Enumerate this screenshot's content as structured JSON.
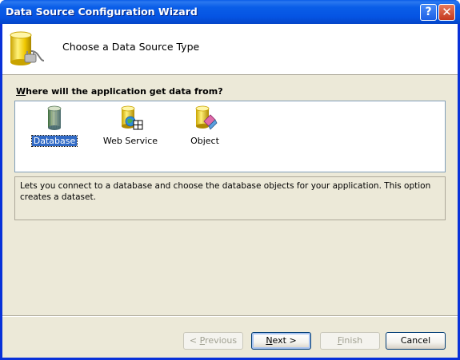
{
  "window": {
    "title": "Data Source Configuration Wizard",
    "help_glyph": "?",
    "close_glyph": "✕"
  },
  "header": {
    "title": "Choose a Data Source Type",
    "icon": "database-plug-icon"
  },
  "question": {
    "underlined_letter": "W",
    "rest": "here will the application get data from?"
  },
  "data_sources": [
    {
      "label": "Database",
      "icon": "database-icon",
      "selected": true
    },
    {
      "label": "Web Service",
      "icon": "web-service-icon",
      "selected": false
    },
    {
      "label": "Object",
      "icon": "object-icon",
      "selected": false
    }
  ],
  "description": "Lets you connect to a database and choose the database objects for your application. This option creates a dataset.",
  "buttons": {
    "previous": {
      "prefix": "< ",
      "mnemonic": "P",
      "rest": "revious",
      "enabled": false
    },
    "next": {
      "mnemonic": "N",
      "rest": "ext >",
      "enabled": true
    },
    "finish": {
      "mnemonic": "F",
      "rest": "inish",
      "enabled": false
    },
    "cancel": {
      "label": "Cancel",
      "enabled": true
    }
  },
  "colors": {
    "titlebar": "#0a5ee8",
    "selection": "#316ac5",
    "dialog_face": "#ece9d8"
  }
}
